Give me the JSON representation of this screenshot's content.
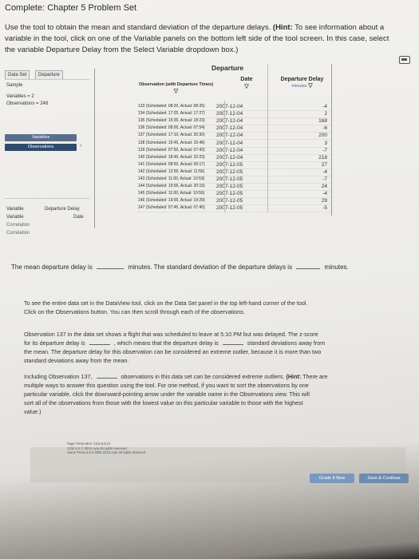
{
  "page_title": "Complete: Chapter 5 Problem Set",
  "instructions": {
    "line1_a": "Use the tool to obtain the mean and standard deviation of the departure delays. ",
    "line1_b": "(Hint:",
    "line1_c": " To see information about a",
    "line2": "variable in the tool, click on one of the Variable panels on the bottom left side of the tool screen. In this case, select",
    "line3": "the variable Departure Delay from the Select Variable dropdown box.)"
  },
  "left_panel": {
    "tab_data_set": "Data Set",
    "tab_departure": "Departure",
    "sample_label": "Sample",
    "variables_label": "Variables = 2",
    "observations_label": "Observations = 248",
    "variables_button": "Variables",
    "observations_button": "Observations",
    "var_col": "Variable",
    "var_col_value": "Departure Delay",
    "var_col2": "Variable",
    "var_col2_value": "Date",
    "correlation1": "Correlation",
    "correlation2": "Correlation"
  },
  "dataview": {
    "header": "Departure",
    "col_obs": "Observation (with Departure Times)",
    "col_date": "Date",
    "col_delay": "Departure Delay",
    "col_delay_sub": "minutes",
    "rows": [
      {
        "obs": "133 (Scheduled: 08:20, Actual: 08:26)",
        "date": "2007-12-04",
        "delay": "-4"
      },
      {
        "obs": "134 (Scheduled: 17:25, Actual: 17:27)",
        "date": "2007-12-04",
        "delay": "2"
      },
      {
        "obs": "135 (Scheduled: 15:35, Actual: 18:23)",
        "date": "2007-12-04",
        "delay": "168"
      },
      {
        "obs": "136 (Scheduled: 08:00, Actual: 07:54)",
        "date": "2007-12-04",
        "delay": "-6"
      },
      {
        "obs": "137 (Scheduled: 17:10, Actual: 20:30)",
        "date": "2007-12-04",
        "delay": "200"
      },
      {
        "obs": "138 (Scheduled: 15:45, Actual: 15:48)",
        "date": "2007-12-04",
        "delay": "3"
      },
      {
        "obs": "139 (Scheduled: 07:50, Actual: 07:43)",
        "date": "2007-12-04",
        "delay": "-7"
      },
      {
        "obs": "140 (Scheduled: 18:45, Actual: 22:23)",
        "date": "2007-12-04",
        "delay": "218"
      },
      {
        "obs": "141 (Scheduled: 08:50, Actual: 09:17)",
        "date": "2007-12-05",
        "delay": "27"
      },
      {
        "obs": "142 (Scheduled: 12:00, Actual: 11:56)",
        "date": "2007-12-05",
        "delay": "-4"
      },
      {
        "obs": "143 (Scheduled: 11:00, Actual: 10:53)",
        "date": "2007-12-05",
        "delay": "-7"
      },
      {
        "obs": "144 (Scheduled: 19:55, Actual: 20:19)",
        "date": "2007-12-05",
        "delay": "24"
      },
      {
        "obs": "145 (Scheduled: 11:00, Actual: 10:56)",
        "date": "2007-12-05",
        "delay": "-4"
      },
      {
        "obs": "146 (Scheduled: 19:00, Actual: 19:29)",
        "date": "2007-12-05",
        "delay": "29"
      },
      {
        "obs": "147 (Scheduled: 07:45, Actual: 07:40)",
        "date": "2007-12-05",
        "delay": "-5"
      }
    ]
  },
  "question1": {
    "part1": "The mean departure delay is",
    "part2": "minutes. The standard deviation of the departure delays is",
    "part3": "minutes."
  },
  "para_dataset": {
    "l1": "To see the entire data set in the DataView tool, click on the Data Set panel in the top left-hand corner of the tool.",
    "l2": "Click on the Observations button. You can then scroll through each of the observations."
  },
  "para_obs137": {
    "l1": "Observation 137 in the data set shows a flight that was scheduled to leave at 5:10 PM but was delayed. The z-score",
    "l2a": "for its departure delay is",
    "l2b": ", which means that the departure delay is",
    "l2c": "standard deviations away from",
    "l3": "the mean. The departure delay for this observation can be considered an extreme outlier, because it is more than two",
    "l4": "standard deviations away from the mean."
  },
  "para_outliers": {
    "l1a": "Including Observation 137,",
    "l1b": "observations in this data set can be considered extreme outliers. ",
    "l1c": "(Hint:",
    "l1d": " There are",
    "l2": "multiple ways to answer this question using the tool. For one method, if you want to sort the observations by one",
    "l3": "particular variable, click the downward-pointing arrow under the variable name in the Observations view. This will",
    "l4": "sort all of the observations from those with the lowest value on this particular variable to those with the highest",
    "l5": "value.)"
  },
  "footer": {
    "copyright1": "Page Press MAC 23,5,6,9,21",
    "copyright2": "1234 5 6 © 2004 Ayia 45 rights reserved",
    "copyright3": "Some Press 4.5 6 2000 2013 Ayia 45 rights reserved",
    "grade_button": "Grade It Now",
    "save_button": "Save & Continue"
  },
  "colors": {
    "button_blue": "#5a6e8c",
    "button_dark": "#2f4a6b",
    "continue_blue": "#6d8bb0",
    "grade_blue": "#7a98bf"
  }
}
